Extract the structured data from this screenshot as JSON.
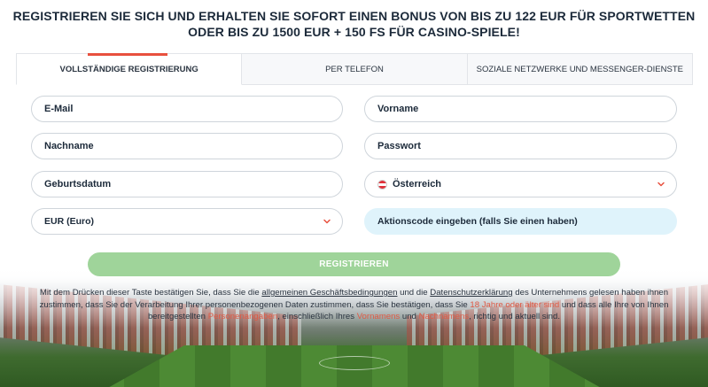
{
  "headline": "REGISTRIEREN SIE SICH UND ERHALTEN SIE SOFORT EINEN BONUS VON BIS ZU 122 EUR FÜR SPORTWETTEN ODER BIS ZU 1500 EUR + 150 FS FÜR CASINO-SPIELE!",
  "tabs": [
    {
      "label": "VOLLSTÄNDIGE REGISTRIERUNG",
      "active": true
    },
    {
      "label": "PER TELEFON",
      "active": false
    },
    {
      "label": "SOZIALE NETZWERKE UND MESSENGER-DIENSTE",
      "active": false
    }
  ],
  "form": {
    "email_placeholder": "E-Mail",
    "firstname_placeholder": "Vorname",
    "lastname_placeholder": "Nachname",
    "password_placeholder": "Passwort",
    "birthdate_placeholder": "Geburtsdatum",
    "country_value": "Österreich",
    "currency_value": "EUR (Euro)",
    "promo_placeholder": "Aktionscode eingeben (falls Sie einen haben)"
  },
  "register_label": "REGISTRIEREN",
  "terms": {
    "p1": "Mit dem Drücken dieser Taste bestätigen Sie, dass Sie die ",
    "link_agb": "allgemeinen Geschäftsbedingungen",
    "p2": " und die ",
    "link_privacy": "Datenschutzerklärung",
    "p3": " des Unternehmens gelesen haben ihnen zustimmen, dass Sie der Verarbeitung Ihrer personenbezogenen Daten zustimmen, dass Sie bestätigen, dass Sie ",
    "age": "18 Jahre oder älter sind",
    "p4": " und dass alle Ihre von Ihnen bereitgestellten ",
    "personal": "Personenangaben",
    "p5": ", einschließlich Ihres ",
    "firstnames": "Vornamens",
    "p6": " und ",
    "lastnames": "Nachnamens",
    "p7": ", richtig und aktuell sind."
  },
  "colors": {
    "accent": "#e8503e",
    "button": "#9fd49a",
    "promo_bg": "#dff3fb"
  }
}
